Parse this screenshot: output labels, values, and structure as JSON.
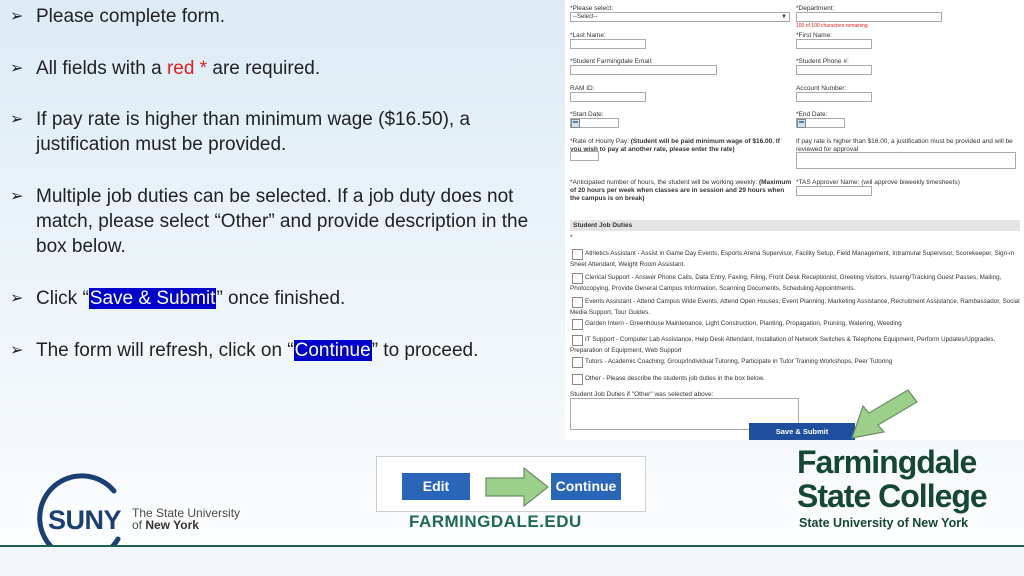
{
  "instructions": {
    "b1": "Please complete form.",
    "b2_pre": "All fields with a ",
    "b2_red": "red *",
    "b2_post": " are required.",
    "b3": "If pay rate is higher than minimum wage ($16.50), a justification must be provided.",
    "b4": "Multiple job duties can be selected. If a job duty does not match, please select “Other” and provide description in the box below.",
    "b5_pre": "Click “",
    "b5_hl": "Save & Submit",
    "b5_post": "” once finished.",
    "b6_pre": "The form will refresh, click on “",
    "b6_hl": "Continue",
    "b6_post": "” to proceed."
  },
  "form": {
    "please_select_label": "*Please select:",
    "please_select_value": "--Select--",
    "department_label": "*Department:",
    "char_note": "100 of 100 characters remaining",
    "last_name_label": "*Last Name:",
    "first_name_label": "*First Name:",
    "email_label": "*Student Farmingdale Email:",
    "phone_label": "*Student Phone #:",
    "ram_label": "RAM ID:",
    "account_label": "Account Number:",
    "start_label": "*Start Date:",
    "end_label": "*End Date:",
    "rate_label_pre": "*Rate of Hourly Pay: ",
    "rate_label_bold": "(Student will be paid minimum wage of $16.00. If you wish to pay at another rate, please enter the rate)",
    "justify_label": "If pay rate is higher than $16.00, a justification must be provided and will be reviewed for approval",
    "hours_label_pre": "*Anticipated number of hours, the student will be working weekly: ",
    "hours_label_bold": "(Maximum of 20 hours per week when classes are in session and 29 hours when the campus is on break)",
    "tas_label": "*TAS Approver Name: (will approve biweekly timesheets)",
    "duties_header": "Student Job Duties",
    "duties_star": "*",
    "duties": [
      "Athletics Assistant - Assist in Game Day Events, Esports Arena Supervisor, Facility Setup, Field Management, Intramural Supervisor, Scorekeeper, Sign-in Sheet Attendant, Weight Room Assistant.",
      "Clerical Support - Answer Phone Calls, Data Entry, Faxing, Filing, Front Desk Receptionist, Greeting Visitors, Issuing/Tracking Guest Passes, Mailing, Photocopying, Provide General Campus Information, Scanning Documents, Scheduling Appointments.",
      "Events Assistant - Attend Campus Wide Events, Attend Open Houses, Event Planning, Marketing Assistance, Recruitment Assistance, Rambassador, Social Media Support, Tour Guides.",
      "Garden Intern - Greenhouse Maintenance, Light Construction, Planting, Propagation, Pruning, Watering, Weeding",
      "IT Support - Computer Lab Assistance, Help Desk Attendant, Installation of Network Switches & Telephone Equipment, Perform Updates/Upgrades, Preparation of Equipment, Web Support",
      "Tutors - Academic Coaching, Group/Individual Tutoring, Participate in Tutor Training Workshops, Peer Tutoring",
      "Other - Please describe the students job duties in the box below."
    ],
    "other_label": "Student Job Duties if \"Other\" was selected above:",
    "save_submit": "Save & Submit"
  },
  "buttons": {
    "edit": "Edit",
    "continue": "Continue"
  },
  "website": "FARMINGDALE.EDU",
  "suny": {
    "word": "SUNY",
    "line1": "The State University",
    "line2_pre": "of ",
    "line2_bold": "New York"
  },
  "fsc": {
    "line1": "Farmingdale",
    "line2": "State College",
    "line3": "State University of New York"
  },
  "colors": {
    "accent_green_arrow": "#9ccf8a",
    "button_blue": "#2a66b8",
    "highlight_blue": "#0000cc",
    "brand_green": "#154734"
  }
}
